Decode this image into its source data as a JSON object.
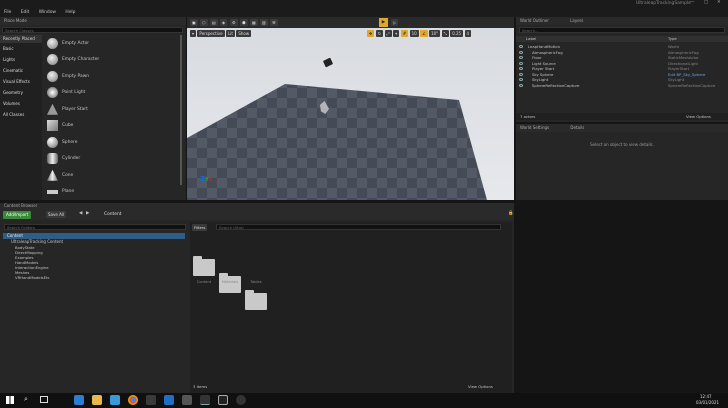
{
  "window": {
    "title": "UltraleapTrackingSample"
  },
  "menu": [
    "File",
    "Edit",
    "Window",
    "Help"
  ],
  "place_panel": {
    "tab": "Place Mode",
    "search_placeholder": "Search Classes",
    "categories": [
      "Recently Placed",
      "Basic",
      "Lights",
      "Cinematic",
      "Visual Effects",
      "Geometry",
      "Volumes",
      "All Classes"
    ],
    "items": [
      "Empty Actor",
      "Empty Character",
      "Empty Pawn",
      "Point Light",
      "Player Start",
      "Cube",
      "Sphere",
      "Cylinder",
      "Cone",
      "Plane"
    ]
  },
  "viewport": {
    "perspective": "Perspective",
    "lit": "Lit",
    "show": "Show",
    "snap_value": "10",
    "rot_value": "10°",
    "scale_value": "0.25",
    "cam_speed": "4"
  },
  "outliner": {
    "tab": "World Outliner",
    "tab2": "Layers",
    "search_placeholder": "Search...",
    "col_label": "Label",
    "col_type": "Type",
    "items": [
      {
        "label": "LeapHandMotion",
        "type": "World"
      },
      {
        "label": "AtmosphericFog",
        "type": "AtmosphericFog"
      },
      {
        "label": "Floor",
        "type": "StaticMeshActor"
      },
      {
        "label": "Light Source",
        "type": "DirectionalLight"
      },
      {
        "label": "Player Start",
        "type": "PlayerStart"
      },
      {
        "label": "Sky Sphere",
        "type": "Edit BP_Sky_Sphere"
      },
      {
        "label": "SkyLight",
        "type": "SkyLight"
      },
      {
        "label": "SphereReflectionCapture",
        "type": "SphereReflectionCapture"
      }
    ],
    "count": "7 actors",
    "view_options": "View Options"
  },
  "details": {
    "tab": "World Settings",
    "tab2": "Details",
    "message": "Select an object to view details."
  },
  "content_browser": {
    "tab": "Content Browser",
    "add_new": "Add/Import",
    "save_all": "Save All",
    "path_label": "Content",
    "filter_placeholder": "Search Folders",
    "filters": "Filters",
    "search_placeholder": "Search Ultral",
    "tree": [
      "Content",
      "UltraleapTracking Content",
      "BodyState",
      "DirectMapping",
      "Examples",
      "HandModels",
      "InteractionEngine",
      "Meshes",
      "VRHandModelsEtc"
    ],
    "folders": [
      "Content",
      "Materials",
      "Tables"
    ],
    "item_count": "3 items",
    "view_options": "View Options"
  },
  "taskbar": {
    "time": "12:47",
    "date": "03/01/2021"
  },
  "colors": {
    "accent": "#e0a72a",
    "add_green": "#3a8a3a",
    "selection": "#2f5d85"
  }
}
